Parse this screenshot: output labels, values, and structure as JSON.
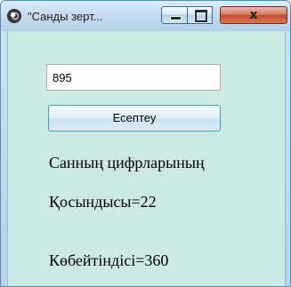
{
  "window": {
    "title": "\"Санды зерт..."
  },
  "form": {
    "number_value": "895",
    "calc_button_label": "Есептеу",
    "heading": "Санның цифрларының",
    "sum_text": "Қосындысы=22",
    "product_text": "Көбейтіндісі=360"
  },
  "icons": {
    "app": "app-icon",
    "minimize": "minimize-icon",
    "maximize": "maximize-icon",
    "close": "close-icon"
  },
  "colors": {
    "client_background": "#cde9e4",
    "close_button": "#c4492c"
  }
}
